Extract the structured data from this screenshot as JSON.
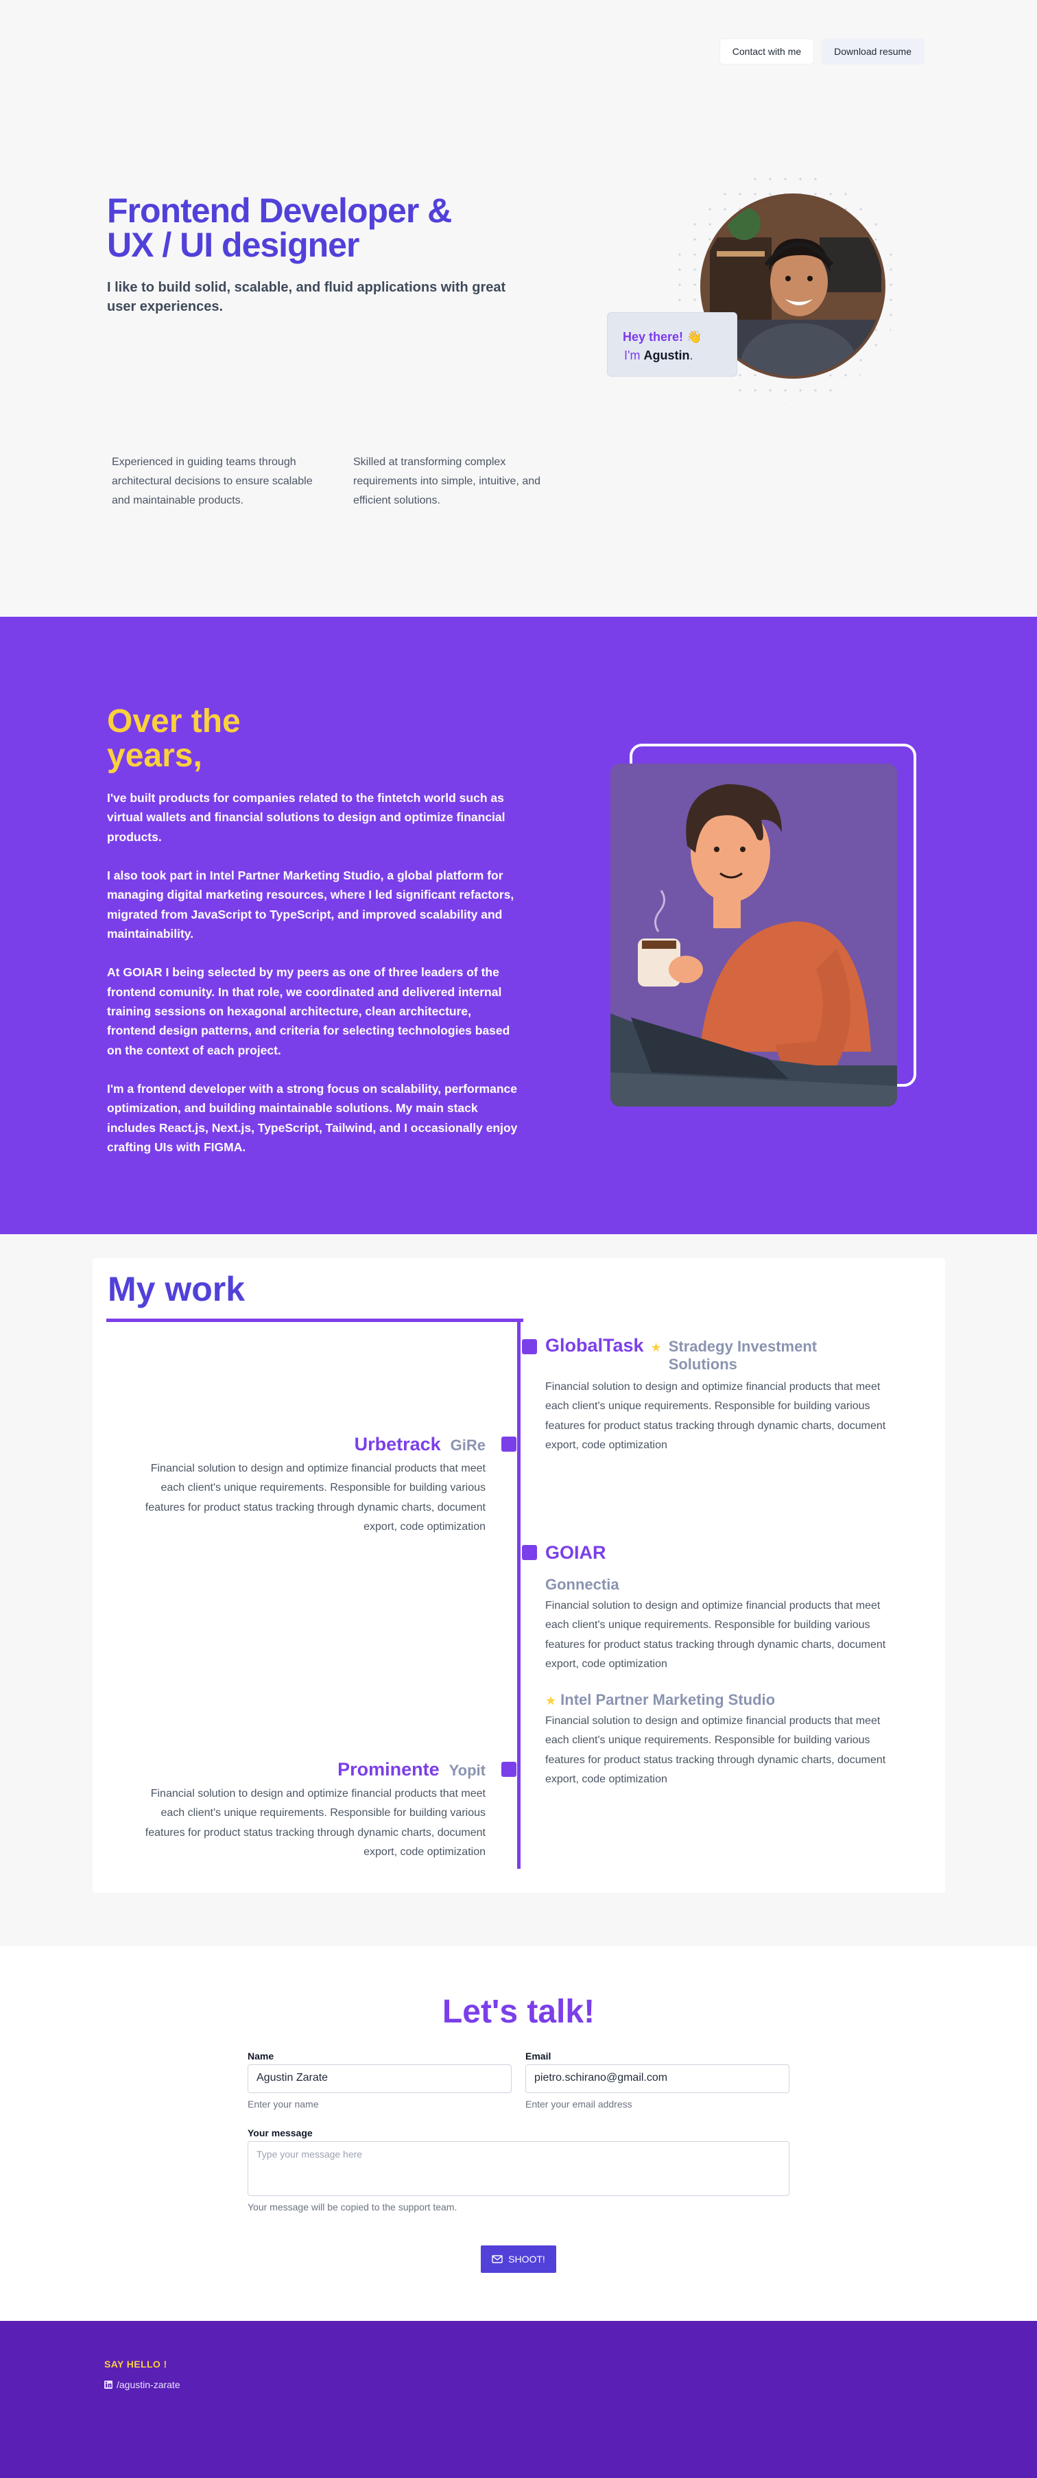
{
  "header": {
    "contact_label": "Contact with me",
    "resume_label": "Download resume"
  },
  "hero": {
    "title_line1": "Frontend Developer &",
    "title_line2": "UX / UI designer",
    "subtitle": "I like to build solid, scalable, and fluid applications with great user experiences.",
    "greeting_hey": "Hey there! 👋",
    "greeting_im": "I'm",
    "greeting_name": "Agustin",
    "greeting_dot": ".",
    "features": [
      "Experienced in guiding teams through architectural decisions to ensure scalable and maintainable products.",
      "Skilled at transforming complex requirements into simple, intuitive, and efficient solutions."
    ]
  },
  "years": {
    "title_line1": "Over the",
    "title_line2": "years,",
    "paragraphs": [
      "I've built products for companies related to the fintetch world such as virtual wallets and financial solutions to design and optimize financial products.",
      "I also took part in Intel Partner Marketing Studio, a global platform for managing digital marketing resources, where I led significant refactors, migrated from JavaScript to TypeScript, and improved scalability and maintainability.",
      "At GOIAR I being selected by my peers as one of three leaders of the frontend comunity. In that role, we coordinated and delivered internal training sessions on hexagonal architecture, clean architecture, frontend design patterns, and criteria for selecting technologies based on the context of each project.",
      "I'm a frontend developer with a strong focus on scalability, performance optimization, and building maintainable solutions. My main stack includes React.js, Next.js, TypeScript,  Tailwind, and  I occasionally enjoy crafting UIs with FIGMA."
    ]
  },
  "work": {
    "title": "My work",
    "jobs": [
      {
        "company": "GlobalTask",
        "client": "Stradegy Investment Solutions",
        "desc": "Financial solution to design and optimize financial products that meet each client's unique requirements. Responsible for building various features for product status tracking through dynamic charts, document export, code optimization"
      },
      {
        "company": "Urbetrack",
        "client": "GiRe",
        "desc": "Financial solution to design and optimize financial products that meet each client's unique requirements. Responsible for building various features for product status tracking through dynamic charts, document export, code optimization"
      },
      {
        "company": "GOIAR",
        "client": "Gonnectia",
        "desc": "Financial solution to design and optimize financial products that meet each client's unique requirements. Responsible for building various features for product status tracking through dynamic charts, document export, code optimization",
        "client2": "Intel Partner Marketing Studio",
        "desc2": "Financial solution to design and optimize financial products that meet each client's unique requirements. Responsible for building various features for product status tracking through dynamic charts, document export, code optimization"
      },
      {
        "company": "Prominente",
        "client": "Yopit",
        "desc": "Financial solution to design and optimize financial products that meet each client's unique requirements. Responsible for building various features for product status tracking through dynamic charts, document export, code optimization"
      }
    ]
  },
  "contact": {
    "title": "Let's talk!",
    "name_label": "Name",
    "name_value": "Agustin Zarate",
    "name_help": "Enter your name",
    "email_label": "Email",
    "email_value": "pietro.schirano@gmail.com",
    "email_help": "Enter your email address",
    "message_label": "Your message",
    "message_placeholder": "Type your message here",
    "message_help": "Your message will be copied to the support team.",
    "submit_label": "SHOOT!"
  },
  "footer": {
    "hello": "SAY HELLO !",
    "github": "/agustin-zarate"
  },
  "colors": {
    "brand_indigo": "#5141d9",
    "brand_purple": "#7b3fe9",
    "accent_yellow": "#fbd13d",
    "footer_purple": "#5a1fb5"
  }
}
